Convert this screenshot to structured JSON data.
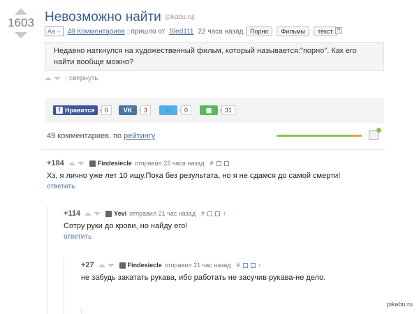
{
  "post": {
    "rating": "1603",
    "title": "Невозможно найти",
    "source": "[pikabu.ru]",
    "font_toggle": "Aa –",
    "comments_link": "49 Комментариев",
    "sent_from": "пришло от",
    "author": "Sled111",
    "time": "22 часа назад",
    "tags": [
      "Порно",
      "Фильмы",
      "текст"
    ],
    "body": "Недавно наткнулся на художественный фильм, который называется:\"порно\". Как его найти вообще можно?",
    "collapse": "свернуть"
  },
  "share": {
    "facebook_label": "Нравится",
    "facebook_count": "0",
    "vk_count": "3",
    "twitter_count": "0",
    "save_count": "31"
  },
  "comments_header": {
    "count_text": "49 комментариев, по",
    "sort_link": "рейтингу"
  },
  "comments": [
    {
      "score": "+184",
      "user": "Findesiecle",
      "time": "отправил 22 часа назад",
      "text": "Хз, я лично уже лет 10 ищу.Пока без результата, но я не сдамся до самой смерти!",
      "reply": "ответить"
    },
    {
      "score": "+114",
      "user": "Yevi",
      "time": "отправил 21 час назад",
      "text": "Сотру руки до крови, но найду его!",
      "reply": "ответить"
    },
    {
      "score": "+27",
      "user": "Findesiecle",
      "time": "отправил 21 час назад",
      "text": "не забудь закатать рукава, ибо работать не засучив рукава-не дело.",
      "reply": ""
    }
  ],
  "watermark": "pikabu.ru",
  "colors": {
    "facebook": "#3b5998",
    "vk": "#4c75a3",
    "twitter": "#55acee",
    "save": "#5cb85c",
    "link": "#4a6f9c"
  }
}
